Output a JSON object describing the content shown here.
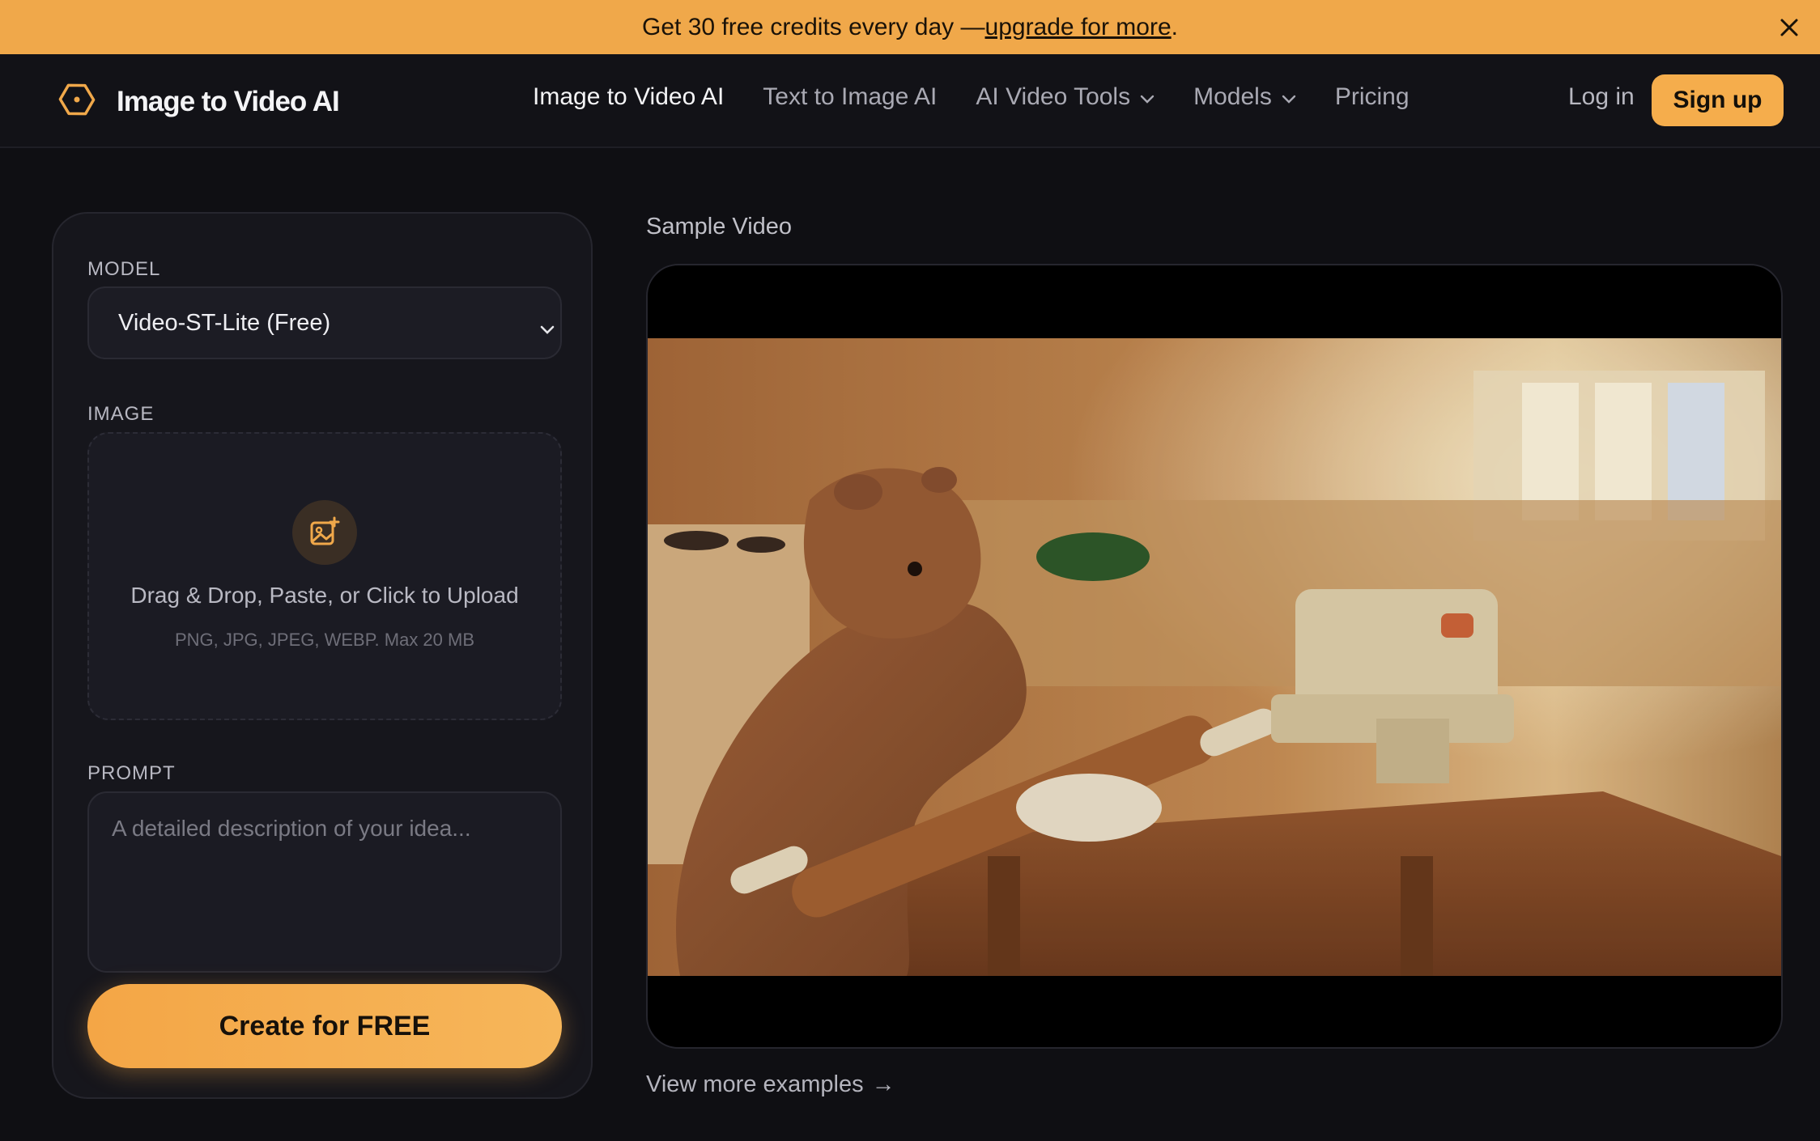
{
  "banner": {
    "text": "Get 30 free credits every day — ",
    "link": "upgrade for more",
    "suffix": "."
  },
  "nav": {
    "brand": "Image to Video AI",
    "links": [
      {
        "label": "Image to Video AI",
        "active": true
      },
      {
        "label": "Text to Image AI"
      },
      {
        "label": "AI Video Tools",
        "dropdown": true
      },
      {
        "label": "Models",
        "dropdown": true
      },
      {
        "label": "Pricing"
      }
    ],
    "login": "Log in",
    "signup": "Sign up"
  },
  "form": {
    "model_label": "MODEL",
    "model_value": "Video-ST-Lite (Free)",
    "image_label": "IMAGE",
    "upload_text": "Drag & Drop, Paste, or Click to Upload",
    "upload_hint": "PNG, JPG, JPEG, WEBP. Max 20 MB",
    "prompt_label": "PROMPT",
    "prompt_placeholder": "A detailed description of your idea...",
    "submit": "Create for FREE"
  },
  "sample": {
    "title": "Sample Video",
    "view_more": "View more examples",
    "view_more_arrow": "→"
  },
  "colors": {
    "accent": "#f5ad4c",
    "background": "#0f0f13",
    "banner": "#f0a84a"
  }
}
